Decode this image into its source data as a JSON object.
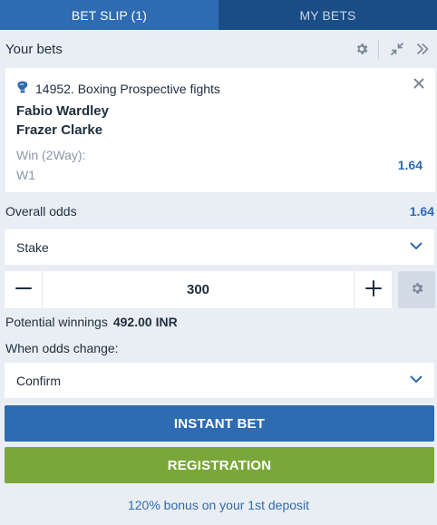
{
  "tabs": [
    {
      "label": "BET SLIP (1)",
      "active": true
    },
    {
      "label": "MY BETS",
      "active": false
    }
  ],
  "your_bets": {
    "title": "Your bets"
  },
  "bet": {
    "event": "14952. Boxing Prospective fights",
    "sport_icon": "boxing-glove-icon",
    "team1": "Fabio Wardley",
    "team2": "Frazer Clarke",
    "market": "Win (2Way):",
    "outcome": "W1",
    "odds": "1.64"
  },
  "overall": {
    "label": "Overall odds",
    "value": "1.64"
  },
  "stake": {
    "label": "Stake",
    "amount": "300"
  },
  "potential": {
    "label": "Potential winnings",
    "value": "492.00 INR"
  },
  "odds_change": {
    "label": "When odds change:",
    "selected": "Confirm"
  },
  "buttons": {
    "instant_bet": "INSTANT BET",
    "registration": "REGISTRATION"
  },
  "bonus_text": "120% bonus on your 1st deposit",
  "colors": {
    "primary": "#2e6bb1",
    "tab_dark": "#1a4c86",
    "registration": "#7aa73a",
    "background": "#e9eef4"
  }
}
